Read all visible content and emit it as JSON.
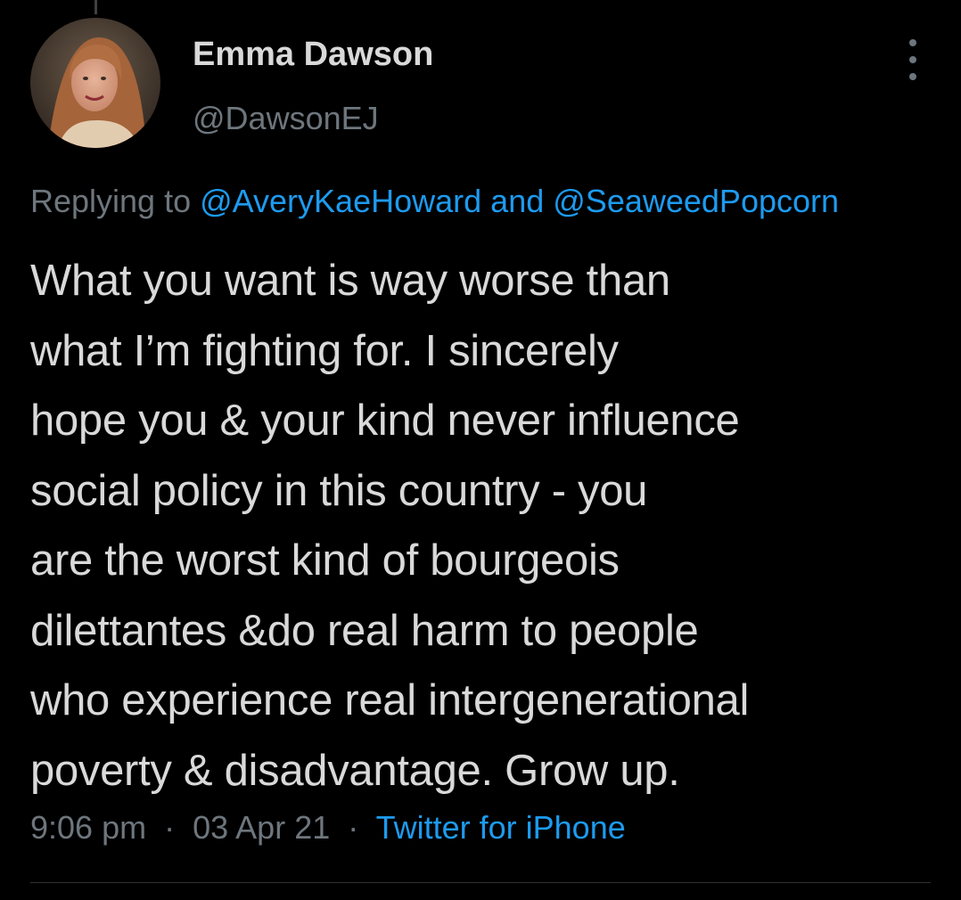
{
  "author": {
    "display_name": "Emma Dawson",
    "handle": "@DawsonEJ"
  },
  "reply": {
    "prefix": "Replying to",
    "mention_1": "@AveryKaeHoward",
    "conjunction": "and",
    "mention_2": "@SeaweedPopcorn"
  },
  "tweet": {
    "lines": [
      "What you want is way worse than",
      "what I’m fighting for. I sincerely",
      "hope you & your kind never influence",
      "social policy in this country - you",
      "are the worst kind of bourgeois",
      "dilettantes &do real harm to people",
      "who experience real intergenerational",
      "poverty & disadvantage. Grow up."
    ]
  },
  "meta": {
    "time": "9:06 pm",
    "separator": "·",
    "date": "03 Apr 21",
    "source": "Twitter for iPhone"
  },
  "icons": {
    "more": "more-vertical-icon"
  },
  "colors": {
    "background": "#000000",
    "text": "#d9d9d9",
    "secondary": "#6e767d",
    "link": "#1d9bf0"
  }
}
